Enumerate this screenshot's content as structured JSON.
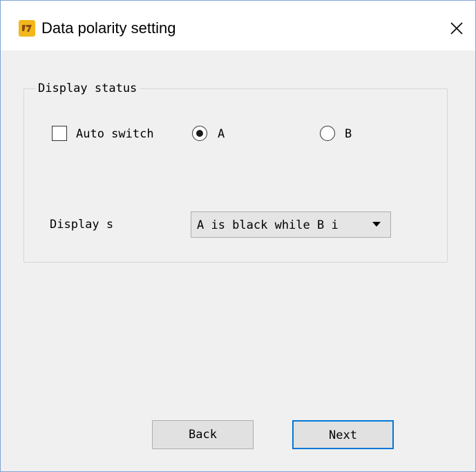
{
  "window": {
    "title": "Data polarity setting",
    "icon": "app-logo-icon",
    "close_icon": "close-icon"
  },
  "display_status": {
    "legend": "Display status",
    "auto_switch": {
      "label": "Auto switch",
      "checked": false
    },
    "radio_a": {
      "label": "A",
      "selected": true
    },
    "radio_b": {
      "label": "B",
      "selected": false
    },
    "display_label": "Display s",
    "display_select": {
      "value": "A is black while B i"
    }
  },
  "footer": {
    "back_label": "Back",
    "next_label": "Next"
  },
  "colors": {
    "accent": "#0078d7",
    "icon_bg": "#f2b81c",
    "window_bg": "#f0f0f0"
  }
}
